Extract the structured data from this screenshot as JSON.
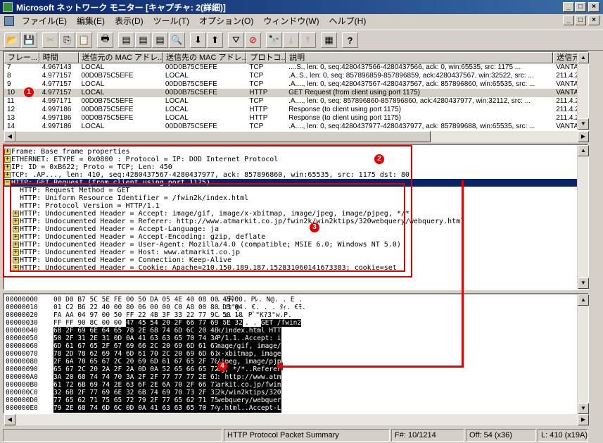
{
  "window": {
    "title": "Microsoft ネットワーク モニター [キャプチャ: 2(詳細)]",
    "min": "_",
    "max": "□",
    "close": "×"
  },
  "menu": [
    "ファイル(E)",
    "編集(E)",
    "表示(D)",
    "ツール(T)",
    "オプション(O)",
    "ウィンドウ(W)",
    "ヘルプ(H)"
  ],
  "toolbar": [
    "open-icon",
    "save-icon",
    "cut-icon",
    "copy-icon",
    "paste-icon",
    "print-icon",
    "pane-summary-icon",
    "pane-detail-icon",
    "pane-hex-icon",
    "zoom-icon",
    "prev-frame-icon",
    "next-frame-icon",
    "filter-icon",
    "display-filter-icon",
    "find-icon",
    "find-next-icon",
    "find-prev-icon",
    "properties-icon",
    "help-icon"
  ],
  "summary": {
    "columns": [
      "フレー...",
      "時間",
      "送信元の MAC アドレ...",
      "送信先の MAC アドレ...",
      "プロトコ...",
      "説明",
      "送信元の"
    ],
    "rows": [
      [
        "7",
        "4.967143",
        "LOCAL",
        "00D0B75C5EFE",
        "TCP",
        "....S., len:    0, seq:4280437566-4280437566, ack:         0, win:65535, src: 1175 ...",
        "VANTAC"
      ],
      [
        "8",
        "4.977157",
        "00D0B75C5EFE",
        "LOCAL",
        "TCP",
        ".A..S., len:    0, seq: 857896859-857896859, ack:4280437567, win:32522, src: ...",
        "211.4.25"
      ],
      [
        "9",
        "4.977157",
        "LOCAL",
        "00D0B75C5EFE",
        "TCP",
        ".A...., len:    0, seq:4280437567-4280437567, ack: 857896860, win:65535, src: ...",
        "VANTAC"
      ],
      [
        "10",
        "4.977157",
        "LOCAL",
        "00D0B75C5EFE",
        "HTTP",
        "GET Request (from client using port 1175)",
        "VANTAC"
      ],
      [
        "11",
        "4.997171",
        "00D0B75C5EFE",
        "LOCAL",
        "TCP",
        ".A...., len:    0, seq: 857896860-857896860, ack:4280437977, win:32112, src: ...",
        "211.4.25"
      ],
      [
        "12",
        "4.997186",
        "00D0B75C5EFE",
        "LOCAL",
        "HTTP",
        "Response (to client using port 1175)",
        "211.4.25"
      ],
      [
        "13",
        "4.997186",
        "00D0B75C5EFE",
        "LOCAL",
        "HTTP",
        "Response (to client using port 1175)",
        "211.4.25"
      ],
      [
        "14",
        "4.997186",
        "LOCAL",
        "00D0B75C5EFE",
        "TCP",
        ".A...., len:    0, seq:4280437977-4280437977, ack: 857899688, win:65535, src: ...",
        "VANTAC"
      ]
    ]
  },
  "detail": [
    "Frame: Base frame properties",
    "ETHERNET: ETYPE = 0x0800 : Protocol = IP:  DOD Internet Protocol",
    "IP: ID = 0xB622; Proto = TCP; Len: 450",
    "TCP: .AP..., len:  410, seq:4280437567-4280437977, ack: 857896860, win:65535, src: 1175  dst:  80",
    "HTTP: GET Request (from client using port 1175)",
    "HTTP: Request Method = GET",
    "HTTP: Uniform Resource Identifier = /fwin2k/index.html",
    "HTTP: Protocol Version = HTTP/1.1",
    "HTTP: Undocumented Header = Accept: image/gif, image/x-xbitmap, image/jpeg, image/pjpeg, */*",
    "HTTP: Undocumented Header = Referer: http://www.atmarkit.co.jp/fwin2k/win2ktips/320webquery/webquery.html",
    "HTTP: Undocumented Header = Accept-Language: ja",
    "HTTP: Undocumented Header = Accept-Encoding: gzip, deflate",
    "HTTP: Undocumented Header = User-Agent: Mozilla/4.0 (compatible; MSIE 6.0; Windows NT 5.0)",
    "HTTP: Undocumented Header = Host: www.atmarkit.co.jp",
    "HTTP: Undocumented Header = Connection: Keep-Alive",
    "HTTP: Undocumented Header = Cookie: Apache=210.150.189.187.152831060141673383; cookie=set"
  ],
  "hex": [
    [
      "00000000",
      "00 D0 B7 5C 5E FE 00 50 DA 05 4E 40 08 00 45 00",
      "",
      "",
      ". ｼ粋^ . Pﾚ. N@. . E ."
    ],
    [
      "00000010",
      "01 C2 B6 22 40 00 80 06 00 00 C0 A8 00 80 D3 04",
      "",
      "",
      ". ﾂｶ\"@ . €. . . ﾀｨ. €ﾓ."
    ],
    [
      "00000020",
      "FA AA 04 97 00 50 FF 22 4B 3F 33 22 77 9C 50 18",
      "",
      "",
      ". ｪ. —. Pﾟ\"K?3\"w.P."
    ],
    [
      "00000030",
      "FF FF 90 8C 00 00 ",
      "47 45 54 20 2F 66 77 69 6E 32",
      "•• . . . . ",
      "GET /fwin2"
    ],
    [
      "00000040",
      "",
      "6B 2F 69 6E 64 65 78 2E 68 74 6D 6C 20 48 54 54",
      "",
      "k/index.html HTT"
    ],
    [
      "00000050",
      "",
      "50 2F 31 2E 31 0D 0A 41 63 63 65 70 74 3A 20 69",
      "",
      "P/1.1..Accept: i"
    ],
    [
      "00000060",
      "",
      "6D 61 67 65 2F 67 69 66 2C 20 69 6D 61 67 65 2F",
      "",
      "mage/gif, image/"
    ],
    [
      "00000070",
      "",
      "78 2D 78 62 69 74 6D 61 70 2C 20 69 6D 61 67 65",
      "",
      "x-xbitmap, image"
    ],
    [
      "00000080",
      "",
      "2F 6A 70 65 67 2C 20 69 6D 61 67 65 2F 70 6A 70",
      "",
      "/jpeg, image/pjp"
    ],
    [
      "00000090",
      "",
      "65 67 2C 20 2A 2F 2A 0D 0A 52 65 66 65 72 65 72",
      "",
      "eg, */*..Referer"
    ],
    [
      "000000A0",
      "",
      "3A 20 68 74 74 70 3A 2F 2F 77 77 77 2E 61 74 6D",
      "",
      ": http://www.atm"
    ],
    [
      "000000B0",
      "",
      "61 72 6B 69 74 2E 63 6F 2E 6A 70 2F 66 77 69 6E",
      "",
      "arkit.co.jp/fwin"
    ],
    [
      "000000C0",
      "",
      "32 6B 2F 77 69 6E 32 6B 74 69 70 73 2F 33 32 30",
      "",
      "2k/win2ktips/320"
    ],
    [
      "000000D0",
      "",
      "77 65 62 71 75 65 72 79 2F 77 65 62 71 75 65 72",
      "",
      "webquery/webquer"
    ],
    [
      "000000E0",
      "",
      "79 2E 68 74 6D 6C 0D 0A 41 63 63 65 70 74 2D 4C",
      "",
      "y.html..Accept-L"
    ],
    [
      "000000F0",
      "",
      "61 6E 67 75 61 67 65 3A 20 6A 61 0D 0A 41 63 63",
      "",
      "anguage: ja..Acc"
    ]
  ],
  "status": {
    "summary": "HTTP Protocol Packet Summary",
    "frame": "F#: 10/1214",
    "offset": "Off: 54 (x36)",
    "length": "L: 410 (x19A)"
  },
  "callouts": [
    "1",
    "2",
    "3",
    "4"
  ],
  "colors": {
    "callout": "#e60000",
    "selection": "#0a246a"
  }
}
